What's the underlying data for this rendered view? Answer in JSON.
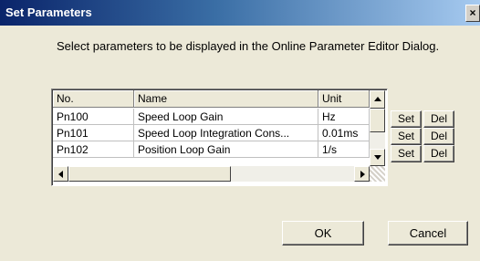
{
  "window": {
    "title": "Set Parameters",
    "close_glyph": "×"
  },
  "instruction": "Select parameters to be displayed in the Online Parameter Editor Dialog.",
  "table": {
    "columns": [
      "No.",
      "Name",
      "Unit"
    ],
    "rows": [
      {
        "no": "Pn100",
        "name": "Speed Loop Gain",
        "unit": "Hz"
      },
      {
        "no": "Pn101",
        "name": "Speed Loop Integration Cons...",
        "unit": "0.01ms"
      },
      {
        "no": "Pn102",
        "name": "Position Loop Gain",
        "unit": "1/s"
      }
    ]
  },
  "row_buttons": [
    {
      "set": "Set",
      "del": "Del"
    },
    {
      "set": "Set",
      "del": "Del"
    },
    {
      "set": "Set",
      "del": "Del"
    }
  ],
  "footer": {
    "ok": "OK",
    "cancel": "Cancel"
  },
  "icons": {
    "scroll_up": "scroll-up-icon",
    "scroll_down": "scroll-down-icon",
    "scroll_left": "scroll-left-icon",
    "scroll_right": "scroll-right-icon"
  },
  "colors": {
    "title_start": "#0a246a",
    "title_end": "#a6caf0",
    "face": "#ece9d8"
  }
}
